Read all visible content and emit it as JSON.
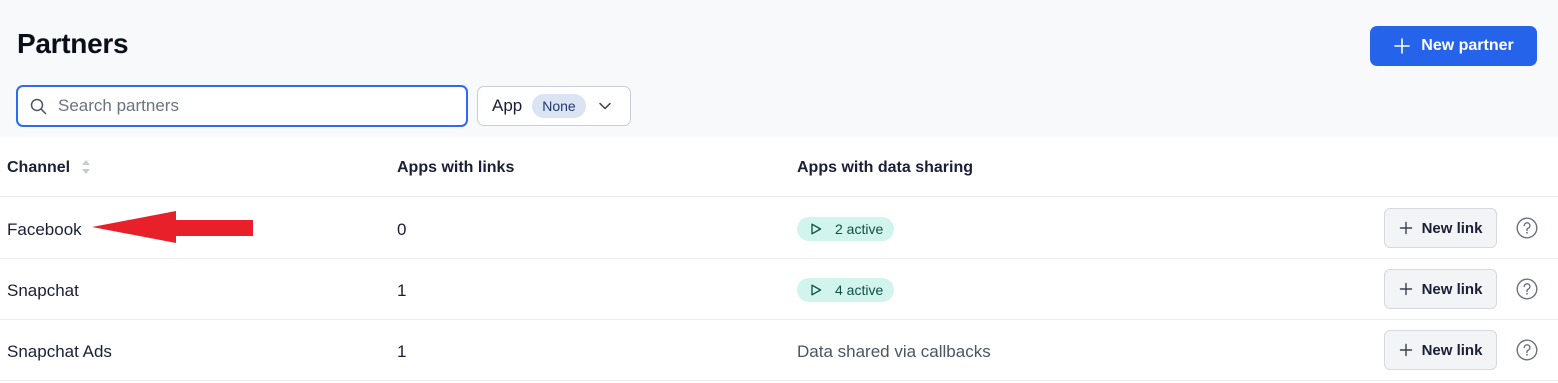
{
  "header": {
    "title": "Partners",
    "new_partner_label": "New partner"
  },
  "filters": {
    "search_placeholder": "Search partners",
    "search_value": "",
    "app_label": "App",
    "app_value": "None"
  },
  "table": {
    "columns": [
      "Channel",
      "Apps with links",
      "Apps with data sharing"
    ],
    "rows": [
      {
        "channel": "Facebook",
        "apps_with_links": "0",
        "data_sharing": "2 active",
        "data_sharing_type": "badge",
        "action": "New link"
      },
      {
        "channel": "Snapchat",
        "apps_with_links": "1",
        "data_sharing": "4 active",
        "data_sharing_type": "badge",
        "action": "New link"
      },
      {
        "channel": "Snapchat Ads",
        "apps_with_links": "1",
        "data_sharing": "Data shared via callbacks",
        "data_sharing_type": "text",
        "action": "New link"
      }
    ]
  },
  "colors": {
    "primary": "#2563eb",
    "badge_bg": "#d1f4ec",
    "annotation": "#e8202a"
  },
  "icons": [
    "plus-icon",
    "search-icon",
    "chevron-down-icon",
    "sort-icon",
    "play-icon",
    "help-icon",
    "annotation-arrow"
  ]
}
